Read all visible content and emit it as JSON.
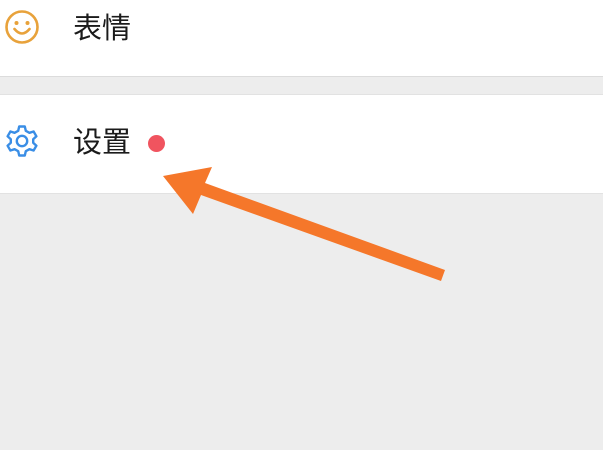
{
  "menu": {
    "items": [
      {
        "label": "表情",
        "icon": "smiley-icon",
        "icon_color": "#e8a23b"
      },
      {
        "label": "设置",
        "icon": "gear-icon",
        "icon_color": "#3a8ee6",
        "has_badge": true,
        "badge_color": "#f0545f"
      }
    ]
  },
  "annotation": {
    "arrow_color": "#f5772a",
    "points_to": "设置"
  },
  "colors": {
    "background": "#ededed",
    "row_background": "#ffffff",
    "text": "#1b1b1b"
  }
}
